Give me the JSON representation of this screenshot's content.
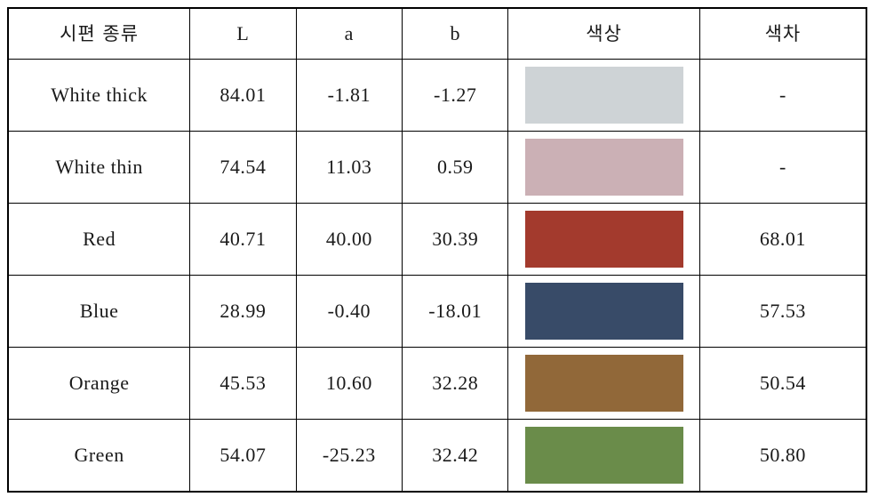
{
  "table": {
    "columns": [
      {
        "key": "type",
        "label": "시편 종류",
        "lang": "ko"
      },
      {
        "key": "L",
        "label": "L",
        "lang": "en"
      },
      {
        "key": "a",
        "label": "a",
        "lang": "en"
      },
      {
        "key": "b",
        "label": "b",
        "lang": "en"
      },
      {
        "key": "swatch",
        "label": "색상",
        "lang": "ko"
      },
      {
        "key": "diff",
        "label": "색차",
        "lang": "ko"
      }
    ],
    "rows": [
      {
        "type": "White thick",
        "L": "84.01",
        "a": "-1.81",
        "b": "-1.27",
        "swatch_color": "#ced3d6",
        "diff": "-"
      },
      {
        "type": "White thin",
        "L": "74.54",
        "a": "11.03",
        "b": "0.59",
        "swatch_color": "#cbb0b5",
        "diff": "-"
      },
      {
        "type": "Red",
        "L": "40.71",
        "a": "40.00",
        "b": "30.39",
        "swatch_color": "#a33a2d",
        "diff": "68.01"
      },
      {
        "type": "Blue",
        "L": "28.99",
        "a": "-0.40",
        "b": "-18.01",
        "swatch_color": "#384b68",
        "diff": "57.53"
      },
      {
        "type": "Orange",
        "L": "45.53",
        "a": "10.60",
        "b": "32.28",
        "swatch_color": "#916839",
        "diff": "50.54"
      },
      {
        "type": "Green",
        "L": "54.07",
        "a": "-25.23",
        "b": "32.42",
        "swatch_color": "#6a8c4a",
        "diff": "50.80"
      }
    ]
  }
}
